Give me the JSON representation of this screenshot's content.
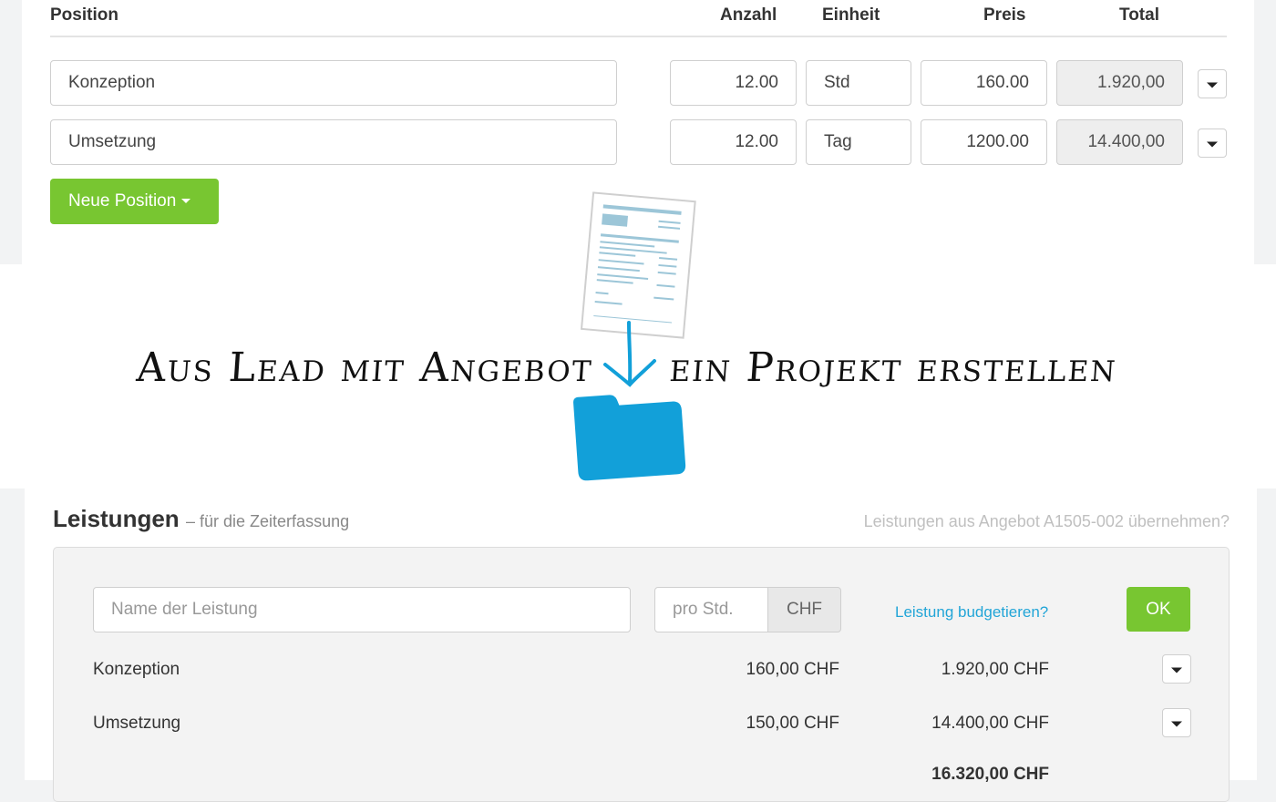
{
  "offer": {
    "headers": {
      "position": "Position",
      "anzahl": "Anzahl",
      "einheit": "Einheit",
      "preis": "Preis",
      "total": "Total"
    },
    "rows": [
      {
        "position": "Konzeption",
        "anzahl": "12.00",
        "einheit": "Std",
        "preis": "160.00",
        "total": "1.920,00"
      },
      {
        "position": "Umsetzung",
        "anzahl": "12.00",
        "einheit": "Tag",
        "preis": "1200.00",
        "total": "14.400,00"
      }
    ],
    "new_position_label": "Neue Position"
  },
  "banner": {
    "left_text": "Aus Lead mit Angebot",
    "right_text": "ein Projekt erstellen"
  },
  "services": {
    "title": "Leistungen",
    "subtitle": "– für die Zeiterfassung",
    "import_link": "Leistungen aus Angebot A1505-002 übernehmen?",
    "name_placeholder": "Name der Leistung",
    "rate_placeholder": "pro Std.",
    "currency": "CHF",
    "budget_link": "Leistung budgetieren?",
    "ok_label": "OK",
    "rows": [
      {
        "name": "Konzeption",
        "rate": "160,00 CHF",
        "total": "1.920,00 CHF"
      },
      {
        "name": "Umsetzung",
        "rate": "150,00 CHF",
        "total": "14.400,00 CHF"
      }
    ],
    "sum": "16.320,00 CHF"
  },
  "colors": {
    "accent_green": "#78c631",
    "accent_blue": "#12a0d9",
    "link_blue": "#22a5d7"
  },
  "icons": [
    "document-icon",
    "arrow-down-icon",
    "folder-icon",
    "caret-down-icon"
  ]
}
